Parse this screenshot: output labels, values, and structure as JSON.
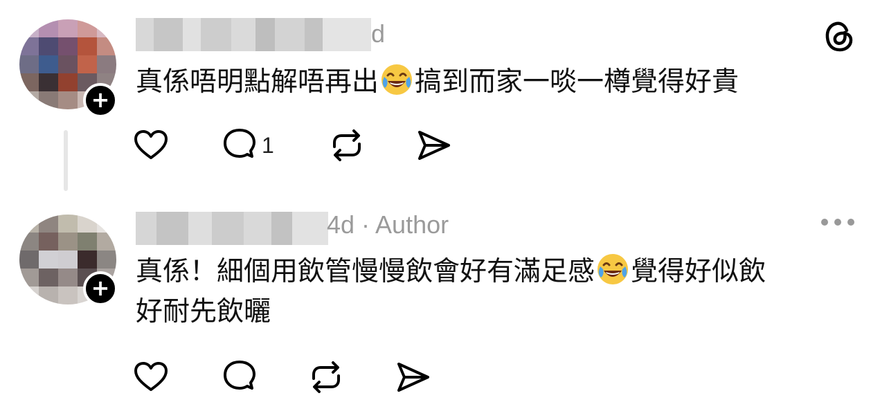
{
  "comment1": {
    "meta_fragment": "d",
    "text_before_emoji": "真係唔明點解唔再出",
    "emoji": "face-with-tears-of-joy",
    "text_after_emoji": "搞到而家一啖一樽覺得好貴",
    "reply_count": "1"
  },
  "comment2": {
    "meta": "4d · Author",
    "text_line1_before_emoji": "真係！細個用飲管慢慢飲會好有滿足感",
    "emoji": "face-with-tears-of-joy",
    "text_line1_after_emoji": "覺得好似飲",
    "text_line2": "好耐先飲曬"
  },
  "icons": {
    "app_logo": "threads-logo-icon",
    "like": "heart-icon",
    "reply": "comment-bubble-icon",
    "repost": "repost-icon",
    "share": "send-icon",
    "more": "more-icon"
  },
  "colors": {
    "text": "#111111",
    "meta": "#9a9a9a",
    "icon": "#000000",
    "emoji_face": "#f7c843"
  }
}
